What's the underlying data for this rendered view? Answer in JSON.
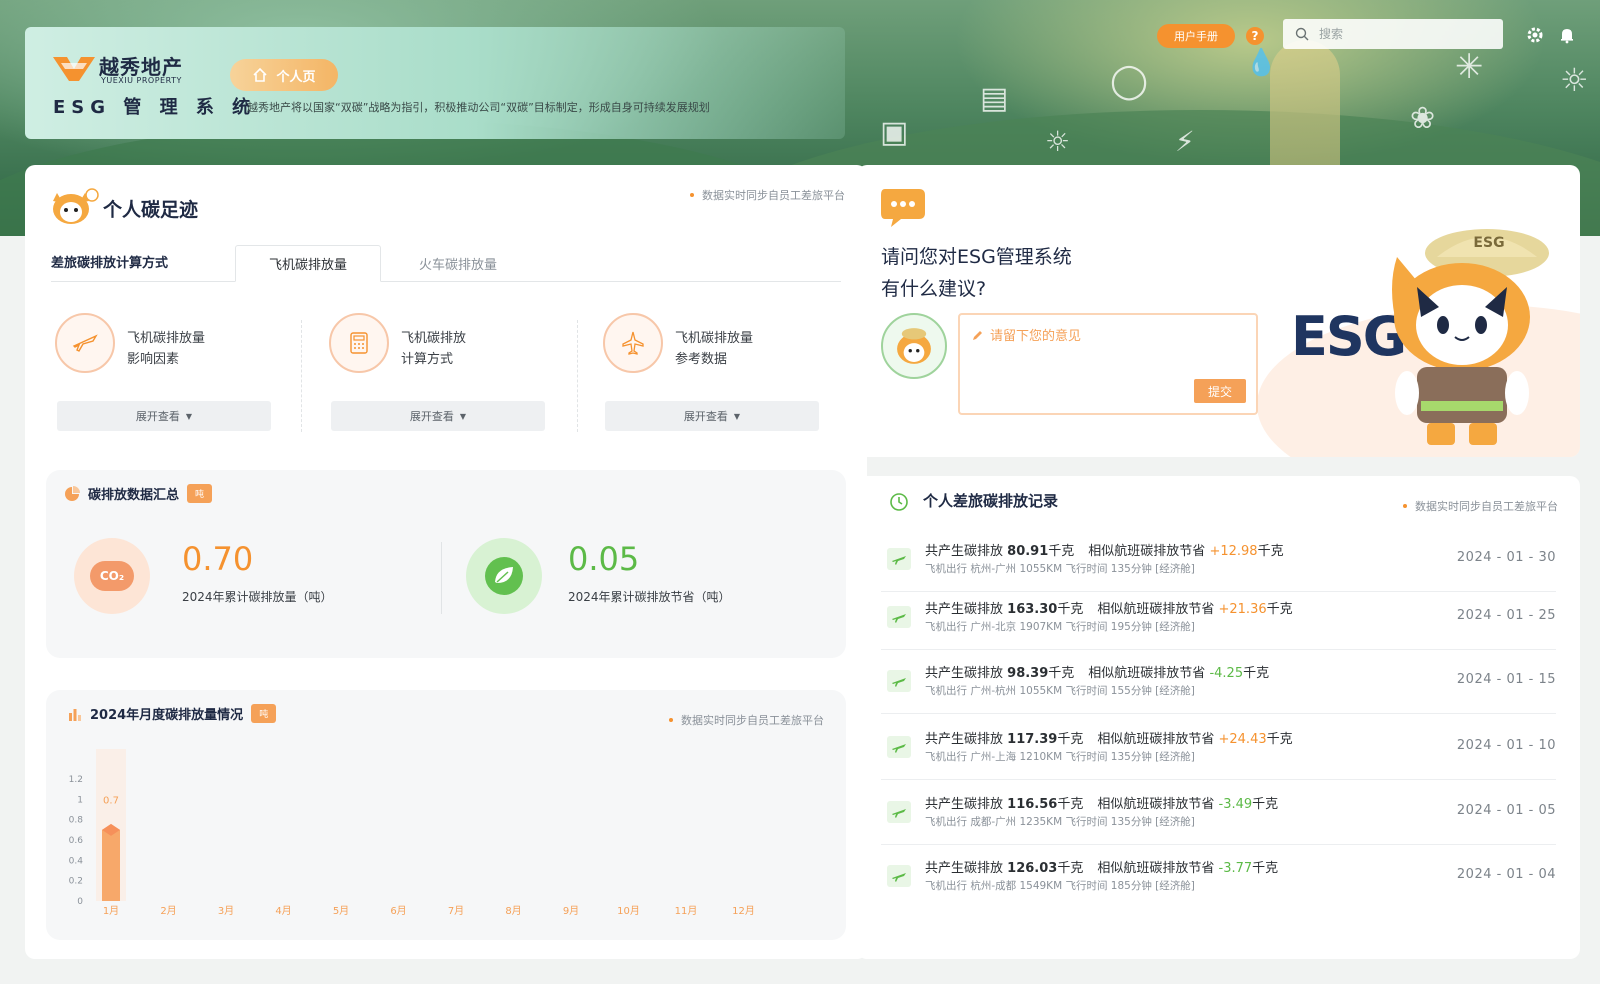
{
  "header": {
    "brand_cn": "越秀地产",
    "brand_en": "YUEXIU PROPERTY",
    "system_name": "ESG 管 理 系 统",
    "home_label": "个人页",
    "description": "越秀地产将以国家“双碳”战略为指引，积极推动公司“双碳”目标制定，形成自身可持续发展规划"
  },
  "toolbar": {
    "manual_label": "用户手册",
    "help_label": "?",
    "search_placeholder": "搜索"
  },
  "footprint": {
    "title": "个人碳足迹",
    "sync_note": "数据实时同步自员工差旅平台",
    "calc_label": "差旅碳排放计算方式",
    "tabs": [
      "飞机碳排放量",
      "火车碳排放量"
    ],
    "factors": [
      {
        "line1": "飞机碳排放量",
        "line2": "影响因素",
        "expand": "展开查看",
        "icon": "airplane-icon"
      },
      {
        "line1": "飞机碳排放",
        "line2": "计算方式",
        "expand": "展开查看",
        "icon": "calculator-icon"
      },
      {
        "line1": "飞机碳排放量",
        "line2": "参考数据",
        "expand": "展开查看",
        "icon": "plane-top-icon"
      }
    ]
  },
  "summary": {
    "title": "碳排放数据汇总",
    "unit": "吨",
    "co2_label": "CO₂",
    "emission_value": "0.70",
    "emission_label": "2024年累计碳排放量（吨）",
    "saving_value": "0.05",
    "saving_label": "2024年累计碳排放节省（吨）"
  },
  "monthly": {
    "title": "2024年月度碳排放量情况",
    "unit": "吨",
    "sync_note": "数据实时同步自员工差旅平台"
  },
  "chart_data": {
    "type": "bar",
    "categories": [
      "1月",
      "2月",
      "3月",
      "4月",
      "5月",
      "6月",
      "7月",
      "8月",
      "9月",
      "10月",
      "11月",
      "12月"
    ],
    "values": [
      0.7,
      0,
      0,
      0,
      0,
      0,
      0,
      0,
      0,
      0,
      0,
      0
    ],
    "data_labels": [
      "0.7"
    ],
    "yticks": [
      "0",
      "0.2",
      "0.4",
      "0.6",
      "0.8",
      "1",
      "1.2"
    ],
    "ylim": [
      0,
      1.2
    ],
    "colors": {
      "bar": "#f7a86a",
      "label": "#f5a158",
      "axis_text": "#f5a158",
      "ytick_text": "#8a9199"
    }
  },
  "suggestion": {
    "question_line1": "请问您对ESG管理系统",
    "question_line2": "有什么建议?",
    "placeholder": "请留下您的意见",
    "submit_label": "提交",
    "esg_word": "ESG",
    "mascot_hat_text": "ESG"
  },
  "records": {
    "title": "个人差旅碳排放记录",
    "sync_note": "数据实时同步自员工差旅平台",
    "emit_prefix": "共产生碳排放",
    "save_prefix": "相似航班碳排放节省",
    "unit": "千克",
    "items": [
      {
        "emission": "80.91",
        "saving": "+12.98",
        "detail": "飞机出行 杭州-广州 1055KM 飞行时间 135分钟 [经济舱]",
        "date": "2024 - 01 - 30"
      },
      {
        "emission": "163.30",
        "saving": "+21.36",
        "detail": "飞机出行 广州-北京 1907KM 飞行时间 195分钟 [经济舱]",
        "date": "2024 - 01 - 25"
      },
      {
        "emission": "98.39",
        "saving": "-4.25",
        "detail": "飞机出行 广州-杭州 1055KM 飞行时间 155分钟 [经济舱]",
        "date": "2024 - 01 - 15"
      },
      {
        "emission": "117.39",
        "saving": "+24.43",
        "detail": "飞机出行 广州-上海 1210KM 飞行时间 135分钟 [经济舱]",
        "date": "2024 - 01 - 10"
      },
      {
        "emission": "116.56",
        "saving": "-3.49",
        "detail": "飞机出行 成都-广州 1235KM 飞行时间 135分钟 [经济舱]",
        "date": "2024 - 01 - 05"
      },
      {
        "emission": "126.03",
        "saving": "-3.77",
        "detail": "飞机出行 杭州-成都 1549KM 飞行时间 185分钟 [经济舱]",
        "date": "2024 - 01 - 04"
      }
    ]
  },
  "colors": {
    "accent_orange": "#f5922f",
    "positive_saving": "#f5922f",
    "negative_saving": "#5cba47",
    "brand_navy": "#1f2a44"
  }
}
